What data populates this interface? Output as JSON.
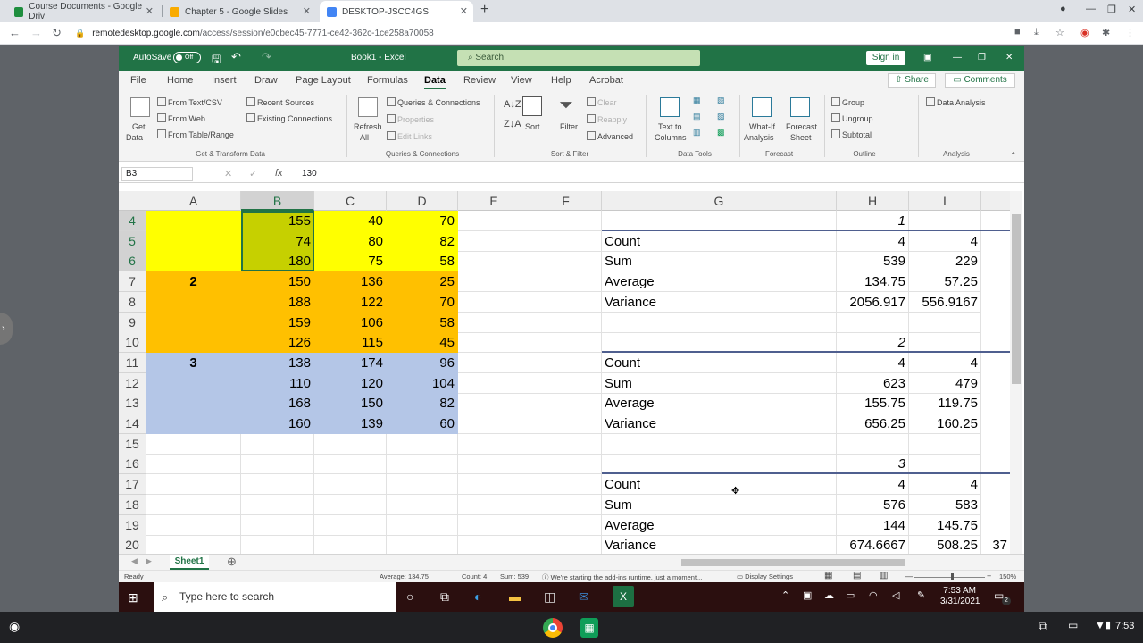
{
  "browser": {
    "tabs": [
      {
        "title": "Course Documents - Google Driv",
        "color": "#1e8e3e"
      },
      {
        "title": "Chapter 5 - Google Slides",
        "color": "#f9ab00"
      },
      {
        "title": "DESKTOP-JSCC4GS",
        "color": "#4285f4"
      }
    ],
    "new_tab": "+",
    "url_host": "remotedesktop.google.com",
    "url_path": "/access/session/e0cbec45-7771-ce42-362c-1ce258a70058"
  },
  "excel": {
    "autosave": "AutoSave",
    "autosave_state": "Off",
    "doc_title": "Book1  -  Excel",
    "search": "Search",
    "sign_in": "Sign in",
    "menus": [
      "File",
      "Home",
      "Insert",
      "Draw",
      "Page Layout",
      "Formulas",
      "Data",
      "Review",
      "View",
      "Help",
      "Acrobat"
    ],
    "share": "Share",
    "comments": "Comments",
    "ribbon": {
      "get_data": "Get",
      "get_data2": "Data",
      "from_text": "From Text/CSV",
      "from_web": "From Web",
      "from_table": "From Table/Range",
      "recent_sources": "Recent Sources",
      "existing_connections": "Existing Connections",
      "group_get": "Get & Transform Data",
      "refresh": "Refresh",
      "refresh2": "All",
      "queries": "Queries & Connections",
      "properties": "Properties",
      "edit_links": "Edit Links",
      "group_queries": "Queries & Connections",
      "sort": "Sort",
      "filter": "Filter",
      "clear": "Clear",
      "reapply": "Reapply",
      "advanced": "Advanced",
      "group_sort": "Sort & Filter",
      "text_to_columns": "Text to",
      "text_to_columns2": "Columns",
      "group_tools": "Data Tools",
      "what_if": "What-If",
      "what_if2": "Analysis",
      "forecast_sheet": "Forecast",
      "forecast_sheet2": "Sheet",
      "group_forecast": "Forecast",
      "group_btn": "Group",
      "ungroup": "Ungroup",
      "subtotal": "Subtotal",
      "group_outline": "Outline",
      "data_analysis": "Data Analysis",
      "group_analysis": "Analysis"
    },
    "name_box": "B3",
    "fx": "fx",
    "formula": "130",
    "columns": [
      "A",
      "B",
      "C",
      "D",
      "E",
      "F",
      "G",
      "H",
      "I"
    ],
    "rows": [
      {
        "n": "4",
        "a": "",
        "b": "155",
        "c": "40",
        "d": "70",
        "g": "",
        "h": "1",
        "i": ""
      },
      {
        "n": "5",
        "a": "",
        "b": "74",
        "c": "80",
        "d": "82",
        "g": "Count",
        "h": "4",
        "i": "4"
      },
      {
        "n": "6",
        "a": "",
        "b": "180",
        "c": "75",
        "d": "58",
        "g": "Sum",
        "h": "539",
        "i": "229"
      },
      {
        "n": "7",
        "a": "2",
        "b": "150",
        "c": "136",
        "d": "25",
        "g": "Average",
        "h": "134.75",
        "i": "57.25"
      },
      {
        "n": "8",
        "a": "",
        "b": "188",
        "c": "122",
        "d": "70",
        "g": "Variance",
        "h": "2056.917",
        "i": "556.9167"
      },
      {
        "n": "9",
        "a": "",
        "b": "159",
        "c": "106",
        "d": "58",
        "g": "",
        "h": "",
        "i": ""
      },
      {
        "n": "10",
        "a": "",
        "b": "126",
        "c": "115",
        "d": "45",
        "g": "",
        "h": "2",
        "i": ""
      },
      {
        "n": "11",
        "a": "3",
        "b": "138",
        "c": "174",
        "d": "96",
        "g": "Count",
        "h": "4",
        "i": "4"
      },
      {
        "n": "12",
        "a": "",
        "b": "110",
        "c": "120",
        "d": "104",
        "g": "Sum",
        "h": "623",
        "i": "479"
      },
      {
        "n": "13",
        "a": "",
        "b": "168",
        "c": "150",
        "d": "82",
        "g": "Average",
        "h": "155.75",
        "i": "119.75"
      },
      {
        "n": "14",
        "a": "",
        "b": "160",
        "c": "139",
        "d": "60",
        "g": "Variance",
        "h": "656.25",
        "i": "160.25"
      },
      {
        "n": "15",
        "a": "",
        "b": "",
        "c": "",
        "d": "",
        "g": "",
        "h": "",
        "i": ""
      },
      {
        "n": "16",
        "a": "",
        "b": "",
        "c": "",
        "d": "",
        "g": "",
        "h": "3",
        "i": ""
      },
      {
        "n": "17",
        "a": "",
        "b": "",
        "c": "",
        "d": "",
        "g": "Count",
        "h": "4",
        "i": "4"
      },
      {
        "n": "18",
        "a": "",
        "b": "",
        "c": "",
        "d": "",
        "g": "Sum",
        "h": "576",
        "i": "583"
      },
      {
        "n": "19",
        "a": "",
        "b": "",
        "c": "",
        "d": "",
        "g": "Average",
        "h": "144",
        "i": "145.75"
      },
      {
        "n": "20",
        "a": "",
        "b": "",
        "c": "",
        "d": "",
        "g": "Variance",
        "h": "674.6667",
        "i": "508.25"
      }
    ],
    "overflow_cell": "37",
    "sheet_tab": "Sheet1",
    "status": {
      "ready": "Ready",
      "average": "Average: 134.75",
      "count": "Count: 4",
      "sum": "Sum: 539",
      "message": "We're starting the add-ins runtime, just a moment...",
      "display_settings": "Display Settings",
      "zoom": "150%"
    }
  },
  "taskbar": {
    "search_placeholder": "Type here to search",
    "time": "7:53 AM",
    "date": "3/31/2021",
    "notifications": "2"
  },
  "chromeos": {
    "time": "7:53"
  }
}
